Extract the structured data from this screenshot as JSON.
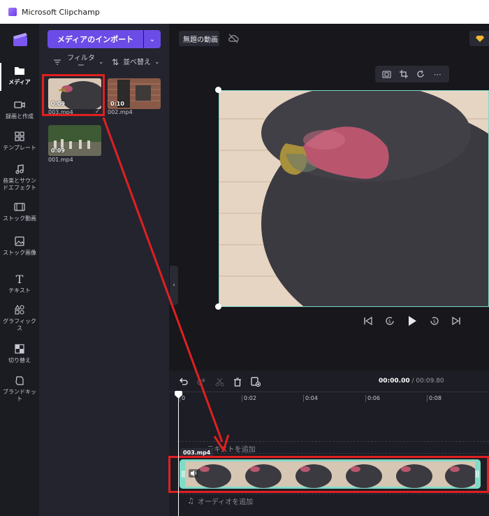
{
  "window": {
    "title": "Microsoft Clipchamp"
  },
  "rail": {
    "items": [
      {
        "label": "メディア",
        "icon": "folder-icon",
        "active": true
      },
      {
        "label": "録画と作成",
        "icon": "record-icon"
      },
      {
        "label": "テンプレート",
        "icon": "templates-icon"
      },
      {
        "label": "音楽とサウンドエフェクト",
        "icon": "music-icon"
      },
      {
        "label": "ストック動画",
        "icon": "stock-video-icon"
      },
      {
        "label": "ストック画像",
        "icon": "stock-image-icon"
      },
      {
        "label": "テキスト",
        "icon": "text-icon"
      },
      {
        "label": "グラフィックス",
        "icon": "graphics-icon"
      },
      {
        "label": "切り替え",
        "icon": "transitions-icon"
      },
      {
        "label": "ブランドキット",
        "icon": "brand-kit-icon"
      }
    ]
  },
  "media": {
    "import_label": "メディアのインポート",
    "filter_label": "フィルター",
    "sort_label": "並べ替え",
    "files": [
      {
        "name": "003.mp4",
        "duration": "0:09"
      },
      {
        "name": "002.mp4",
        "duration": "0:10"
      },
      {
        "name": "001.mp4",
        "duration": "0:09"
      }
    ]
  },
  "project": {
    "name": "無題の動画"
  },
  "timeline": {
    "current_time": "00:00.00",
    "separator": "/",
    "total_time": "00:09.80",
    "ticks": [
      "0",
      "0:02",
      "0:04",
      "0:06",
      "0:08"
    ],
    "text_track_placeholder": "テキストを追加",
    "audio_track_placeholder": "オーディオを追加",
    "clip_label": "003.mp4"
  },
  "colors": {
    "accent": "#6c4ce6",
    "clip": "#7fdcc6",
    "annotation": "#e02020"
  }
}
